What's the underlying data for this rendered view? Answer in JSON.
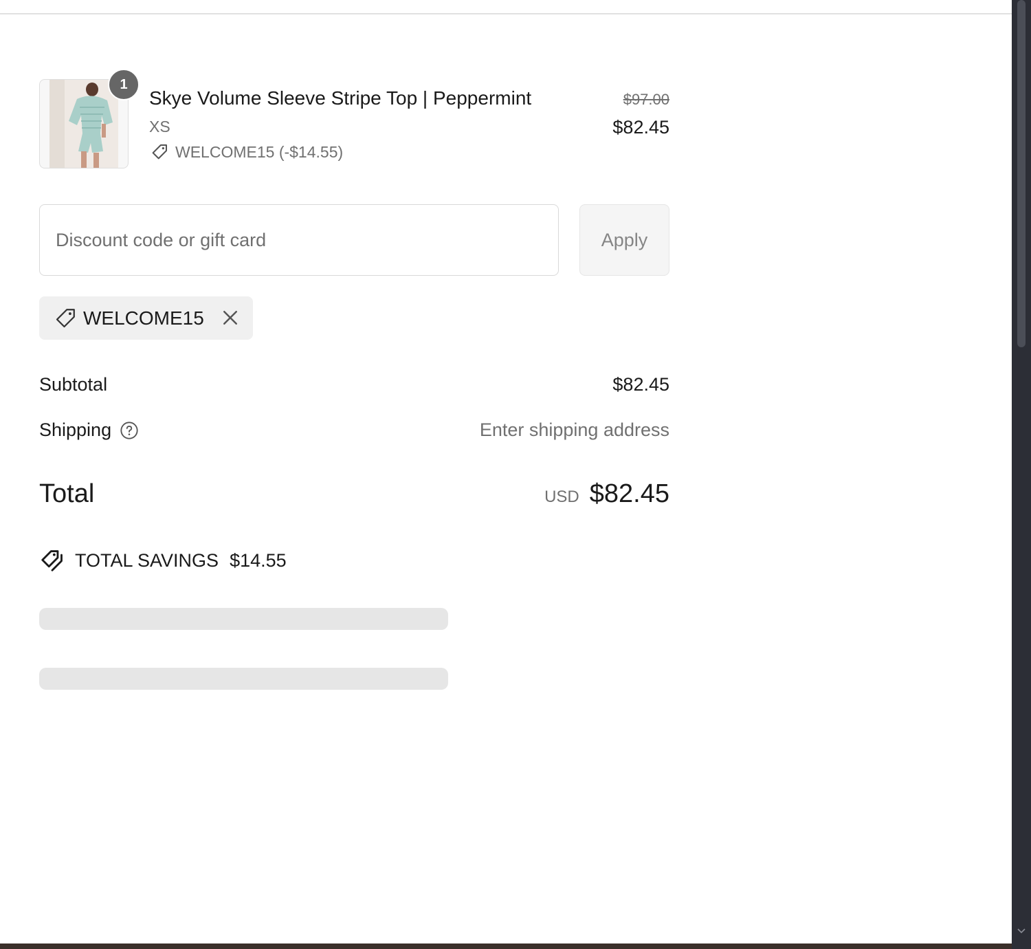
{
  "line_item": {
    "quantity": "1",
    "name": "Skye Volume Sleeve Stripe Top | Peppermint",
    "variant": "XS",
    "discount_applied": "WELCOME15 (-$14.55)",
    "original_price": "$97.00",
    "price": "$82.45"
  },
  "discount_form": {
    "placeholder": "Discount code or gift card",
    "apply_label": "Apply"
  },
  "applied_code": {
    "code": "WELCOME15"
  },
  "totals": {
    "subtotal_label": "Subtotal",
    "subtotal_value": "$82.45",
    "shipping_label": "Shipping",
    "shipping_value": "Enter shipping address",
    "total_label": "Total",
    "currency": "USD",
    "total_value": "$82.45",
    "savings_label": "TOTAL SAVINGS",
    "savings_value": "$14.55"
  },
  "icons": {
    "discount_tag": "tag-icon",
    "remove_code": "close-icon",
    "shipping_help": "question-circle-icon",
    "savings": "double-tag-icon"
  },
  "colors": {
    "badge": "#666666",
    "muted_text": "#707070",
    "skeleton": "#e6e6e6",
    "chip_background": "#f0f0f0"
  }
}
